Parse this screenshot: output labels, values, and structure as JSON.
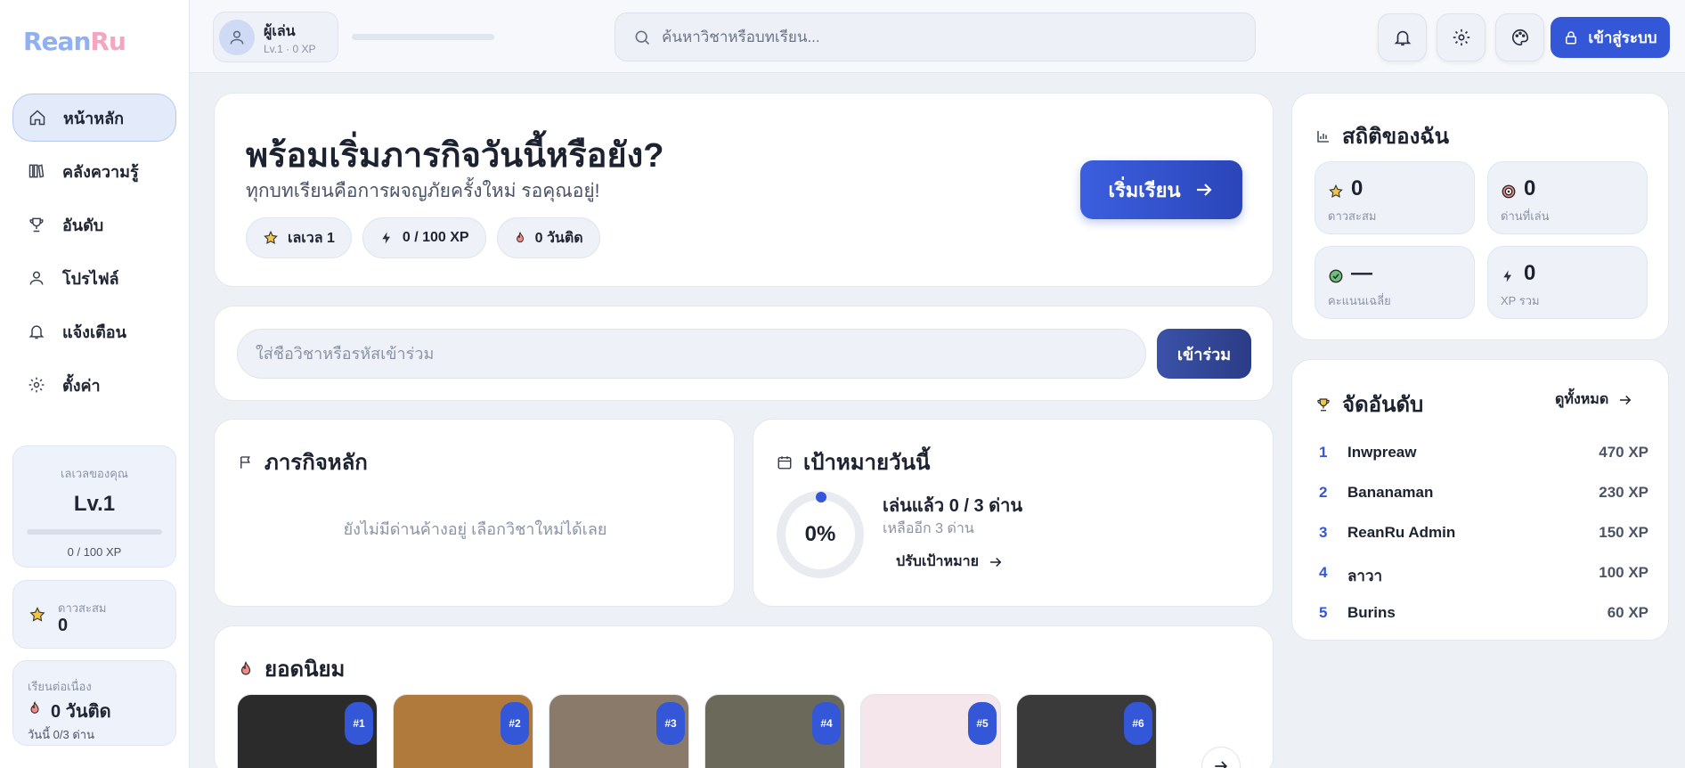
{
  "brand": {
    "logo_a": "Rean",
    "logo_b": "Ru"
  },
  "sidebar": {
    "items": [
      {
        "label": "หน้าหลัก",
        "icon": "home-icon"
      },
      {
        "label": "คลังความรู้",
        "icon": "library-icon"
      },
      {
        "label": "อันดับ",
        "icon": "trophy-icon"
      },
      {
        "label": "โปรไฟล์",
        "icon": "user-icon"
      },
      {
        "label": "แจ้งเตือน",
        "icon": "bell-icon"
      },
      {
        "label": "ตั้งค่า",
        "icon": "gear-icon"
      }
    ],
    "level_card": {
      "caption": "เลเวลของคุณ",
      "level": "Lv.1",
      "xp": "0 / 100 XP",
      "progress": 0
    },
    "stars_card": {
      "caption": "ดาวสะสม",
      "value": "0"
    },
    "streak_card": {
      "caption": "เรียนต่อเนื่อง",
      "value": "0 วันติด",
      "sub": "วันนี้ 0/3 ด่าน"
    }
  },
  "topbar": {
    "user": {
      "name": "ผู้เล่น",
      "level": "Lv.1 · 0 XP"
    },
    "search_placeholder": "ค้นหาวิชาหรือบทเรียน...",
    "login_label": "เข้าสู่ระบบ"
  },
  "hero": {
    "title": "พร้อมเริ่มภารกิจวันนี้หรือยัง?",
    "subtitle": "ทุกบทเรียนคือการผจญภัยครั้งใหม่ รอคุณอยู่!",
    "chips": {
      "level": "เลเวล 1",
      "xp": "0 / 100 XP",
      "streak": "0 วันติด"
    },
    "start_label": "เริ่มเรียน"
  },
  "join": {
    "placeholder": "ใส่ชื่อวิชาหรือรหัสเข้าร่วม",
    "button": "เข้าร่วม"
  },
  "missions": {
    "title": "ภารกิจหลัก",
    "empty": "ยังไม่มีด่านค้างอยู่ เลือกวิชาใหม่ได้เลย"
  },
  "goal": {
    "title": "เป้าหมายวันนี้",
    "percent": "0%",
    "played": "เล่นแล้ว 0 / 3 ด่าน",
    "left": "เหลืออีก 3 ด่าน",
    "adjust": "ปรับเป้าหมาย"
  },
  "popular": {
    "title": "ยอดนิยม",
    "items": [
      {
        "badge": "#1",
        "color": "#2b2b2b"
      },
      {
        "badge": "#2",
        "color": "#b07a3c"
      },
      {
        "badge": "#3",
        "color": "#8a7a6a"
      },
      {
        "badge": "#4",
        "color": "#6b6a5a"
      },
      {
        "badge": "#5",
        "color": "#f4e6ea"
      },
      {
        "badge": "#6",
        "color": "#3a3a3a"
      }
    ]
  },
  "stats": {
    "title": "สถิติของฉัน",
    "boxes": [
      {
        "value": "0",
        "caption": "ดาวสะสม"
      },
      {
        "value": "0",
        "caption": "ด่านที่เล่น"
      },
      {
        "value": "—",
        "caption": "คะแนนเฉลี่ย"
      },
      {
        "value": "0",
        "caption": "XP รวม"
      }
    ]
  },
  "ranking": {
    "title": "จัดอันดับ",
    "see_all": "ดูทั้งหมด",
    "rows": [
      {
        "rank": "1",
        "name": "Inwpreaw",
        "xp": "470 XP"
      },
      {
        "rank": "2",
        "name": "Bananaman",
        "xp": "230 XP"
      },
      {
        "rank": "3",
        "name": "ReanRu Admin",
        "xp": "150 XP"
      },
      {
        "rank": "4",
        "name": "ลาวา",
        "xp": "100 XP"
      },
      {
        "rank": "5",
        "name": "Burins",
        "xp": "60 XP"
      }
    ]
  },
  "colors": {
    "accent": "#3357d6",
    "background": "#edf0f5"
  }
}
